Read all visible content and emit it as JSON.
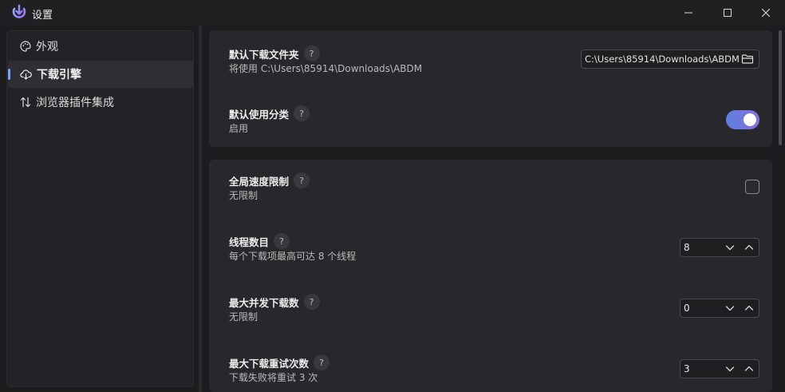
{
  "window": {
    "title": "设置",
    "logo_icon": "app-logo-icon",
    "controls": [
      "minimize-icon",
      "maximize-icon",
      "close-icon"
    ]
  },
  "sidebar": {
    "items": [
      {
        "label": "外观",
        "icon": "palette-icon",
        "active": false
      },
      {
        "label": "下载引擎",
        "icon": "cloud-download-icon",
        "active": true
      },
      {
        "label": "浏览器插件集成",
        "icon": "sort-arrows-icon",
        "active": false
      }
    ]
  },
  "settings": {
    "download_folder": {
      "label": "默认下载文件夹",
      "help": "?",
      "desc": "将使用 C:\\Users\\85914\\Downloads\\ABDM",
      "value": "C:\\Users\\85914\\Downloads\\ABDM",
      "icon": "folder-icon"
    },
    "default_category": {
      "label": "默认使用分类",
      "help": "?",
      "desc": "启用",
      "enabled": true
    },
    "speed_limit": {
      "label": "全局速度限制",
      "help": "?",
      "desc": "无限制",
      "checked": false
    },
    "threads": {
      "label": "线程数目",
      "help": "?",
      "desc": "每个下载项最高可达 8 个线程",
      "value": "8"
    },
    "max_concurrent": {
      "label": "最大并发下载数",
      "help": "?",
      "desc": "无限制",
      "value": "0"
    },
    "max_retries": {
      "label": "最大下载重试次数",
      "help": "?",
      "desc": "下载失败将重试 3 次",
      "value": "3"
    }
  },
  "colors": {
    "accent": "#7da0ff",
    "toggle_start": "#5b7fe0",
    "toggle_end": "#8a6fe0"
  }
}
